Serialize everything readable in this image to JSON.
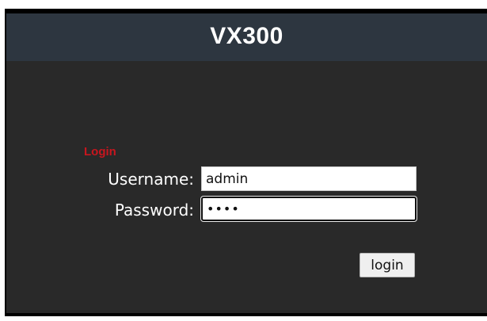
{
  "header": {
    "title": "VX300"
  },
  "login_form": {
    "heading": "Login",
    "username_label": "Username:",
    "username_value": "admin",
    "password_label": "Password:",
    "password_value": "test",
    "submit_label": "login"
  },
  "colors": {
    "header_bg": "#2d3640",
    "body_bg": "#292929",
    "heading_red": "#c8161e",
    "label_text": "#ffffff"
  }
}
